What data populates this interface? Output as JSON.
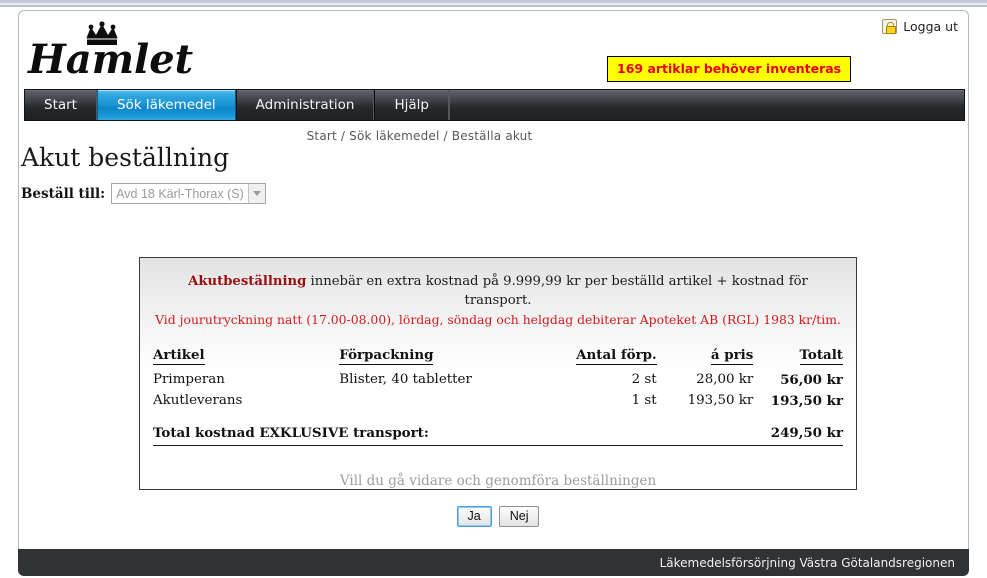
{
  "header": {
    "logo_text": "Hamlet",
    "logo_icon": "crown-icon",
    "logout_label": "Logga ut",
    "logout_icon": "lock-icon",
    "inventory_badge": "169 artiklar behöver inventeras"
  },
  "nav": {
    "items": [
      {
        "label": "Start",
        "active": false
      },
      {
        "label": "Sök läkemedel",
        "active": true
      },
      {
        "label": "Administration",
        "active": false
      },
      {
        "label": "Hjälp",
        "active": false
      }
    ]
  },
  "breadcrumb": "Start / Sök läkemedel / Beställa akut",
  "page_title": "Akut beställning",
  "order_to": {
    "label": "Beställ till:",
    "selected": "Avd 18 Kärl-Thorax (S)",
    "arrow_icon": "chevron-down-icon"
  },
  "order_box": {
    "notice_strong": "Akutbeställning",
    "notice_rest": " innebär en extra kostnad på 9.999,99 kr per beställd artikel + kostnad för transport.",
    "notice_line2": "Vid jourutryckning natt (17.00-08.00), lördag, söndag och helgdag debiterar Apoteket AB (RGL) 1983 kr/tim.",
    "columns": [
      "Artikel",
      "Förpackning",
      "Antal förp.",
      "á pris",
      "Totalt"
    ],
    "rows": [
      {
        "artikel": "Primperan",
        "forpackning": "Blister, 40 tabletter",
        "antal": "2 st",
        "apris": "28,00 kr",
        "totalt": "56,00 kr"
      },
      {
        "artikel": "Akutleverans",
        "forpackning": "",
        "antal": "1 st",
        "apris": "193,50 kr",
        "totalt": "193,50 kr"
      }
    ],
    "total_label": "Total kostnad EXKLUSIVE transport:",
    "total_value": "249,50 kr",
    "confirm_question": "Vill du gå vidare och genomföra beställningen",
    "yes_label": "Ja",
    "no_label": "Nej"
  },
  "footer": {
    "text": "Läkemedelsförsörjning Västra Götalandsregionen"
  },
  "colors": {
    "accent_blue": "#1b94d3",
    "badge_yellow": "#ffff00",
    "badge_red": "#e8000d",
    "notice_red": "#d11b1b",
    "footer_bg": "#303236",
    "navbar_dark": "#232528"
  }
}
